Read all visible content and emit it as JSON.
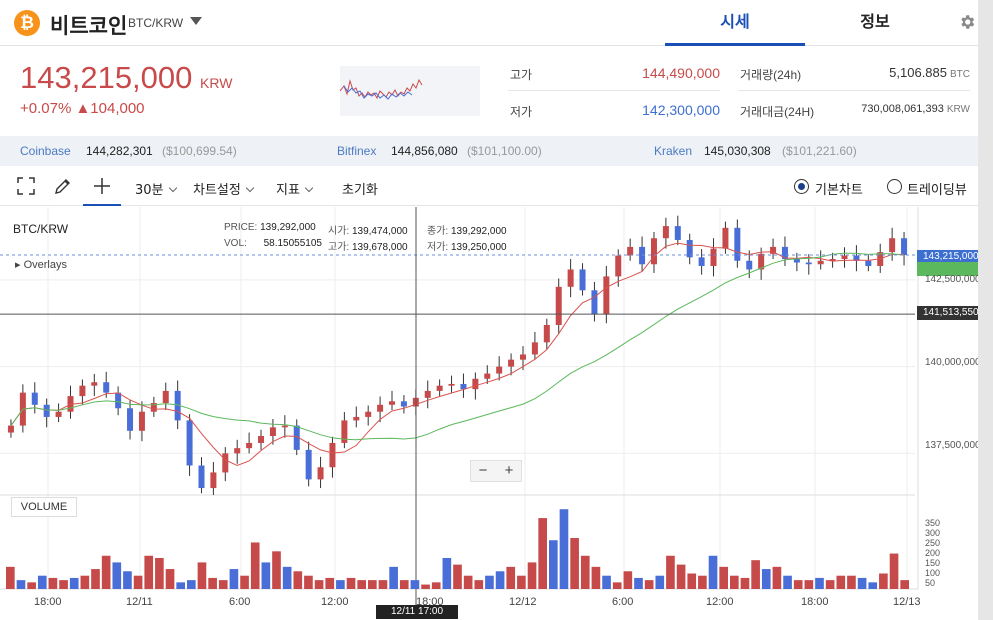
{
  "header": {
    "coin_logo": "₿",
    "coin_name": "비트코인",
    "pair": "BTC/KRW",
    "tabs": [
      "시세",
      "정보"
    ],
    "active_tab": "시세"
  },
  "price": {
    "current": "143,215,000",
    "unit": "KRW",
    "change": "+0.07% ▲104,000"
  },
  "stats": {
    "high_label": "고가",
    "high_value": "144,490,000",
    "low_label": "저가",
    "low_value": "142,300,000",
    "volume_label": "거래량(24h)",
    "volume_value": "5,106.885",
    "volume_unit": "BTC",
    "amount_label": "거래대금(24H)",
    "amount_value": "730,008,061,393",
    "amount_unit": "KRW"
  },
  "exchanges": [
    {
      "name": "Coinbase",
      "krw": "144,282,301",
      "usd": "($100,699.54)"
    },
    {
      "name": "Bitfinex",
      "krw": "144,856,080",
      "usd": "($101,100.00)"
    },
    {
      "name": "Kraken",
      "krw": "145,030,308",
      "usd": "($101,221.60)"
    }
  ],
  "toolbar": {
    "interval": "30분",
    "chart_settings": "차트설정",
    "indicators": "지표",
    "reset": "초기화",
    "radio_basic": "기본차트",
    "radio_tradingview": "트레이딩뷰"
  },
  "chart": {
    "title": "BTC/KRW",
    "overlays": "▸ Overlays",
    "price_label": "PRICE:",
    "price_value": "139,292,000",
    "vol_label": "VOL:",
    "vol_value": "58.15055105",
    "open_label": "시가:",
    "open_value": "139,474,000",
    "high_label": "고가:",
    "high_value": "139,678,000",
    "close_label": "종가:",
    "close_value": "139,292,000",
    "low_label": "저가:",
    "low_value": "139,250,000",
    "volume_label": "VOLUME",
    "price_axis": [
      "142,500,000",
      "140,000,000",
      "137,500,000"
    ],
    "volume_axis": [
      "350",
      "300",
      "250",
      "200",
      "150",
      "100",
      "50"
    ],
    "time_axis": [
      "18:00",
      "12/11",
      "6:00",
      "12:00",
      "18:00",
      "12/12",
      "6:00",
      "12:00",
      "18:00",
      "12/13"
    ],
    "current_price_tag": "143,215,000",
    "cursor_price_tag": "141,513,550",
    "cursor_time": "12/11 17:00",
    "zoom_out": "−",
    "zoom_in": "+",
    "colors": {
      "up": "#c74a4a",
      "down": "#4a6ed8",
      "ma_short": "#d9534f",
      "ma_long": "#5cb85c"
    }
  },
  "chart_data": {
    "type": "candlestick",
    "ylim": [
      136300000,
      144600000
    ],
    "time_labels": [
      "18:00",
      "12/11",
      "6:00",
      "12:00",
      "18:00",
      "12/12",
      "6:00",
      "12:00",
      "18:00",
      "12/13"
    ],
    "candles_close": [
      138300000,
      139250000,
      138900000,
      138550000,
      138700000,
      139150000,
      139450000,
      139550000,
      139250000,
      138800000,
      138150000,
      138700000,
      138950000,
      139300000,
      138450000,
      137150000,
      136500000,
      136950000,
      137500000,
      137650000,
      137800000,
      138000000,
      138250000,
      138300000,
      137600000,
      136750000,
      137100000,
      137800000,
      138450000,
      138550000,
      138700000,
      138900000,
      139000000,
      138850000,
      139100000,
      139300000,
      139450000,
      139500000,
      139350000,
      139650000,
      139800000,
      140000000,
      140200000,
      140350000,
      140700000,
      141200000,
      142300000,
      142800000,
      142200000,
      141500000,
      142600000,
      143200000,
      143450000,
      142950000,
      143700000,
      144050000,
      143650000,
      143150000,
      142900000,
      143400000,
      144000000,
      143050000,
      142800000,
      143250000,
      143450000,
      143100000,
      143000000,
      142950000,
      143050000,
      143100000,
      143200000,
      143050000,
      142900000,
      143300000,
      143700000,
      143215000
    ],
    "volumes": [
      100,
      40,
      30,
      60,
      50,
      40,
      50,
      60,
      90,
      150,
      120,
      80,
      60,
      150,
      140,
      90,
      30,
      40,
      120,
      50,
      40,
      90,
      60,
      210,
      120,
      170,
      100,
      80,
      60,
      40,
      50,
      40,
      50,
      40,
      40,
      40,
      100,
      40,
      40,
      20,
      30,
      140,
      110,
      60,
      40,
      60,
      80,
      100,
      60,
      120,
      320,
      220,
      360,
      230,
      150,
      100,
      60,
      30,
      80,
      50,
      40,
      60,
      150,
      110,
      70,
      60,
      150,
      100,
      60,
      50,
      130,
      90,
      100,
      60,
      40,
      40,
      50,
      40,
      60,
      60,
      50,
      30,
      70,
      160,
      40
    ],
    "price_axis_values": [
      142500000,
      140000000,
      137500000
    ],
    "current_price": 143215000,
    "cursor_price": 141513550,
    "ma_short_color": "#d9534f",
    "ma_long_color": "#5cb85c"
  }
}
